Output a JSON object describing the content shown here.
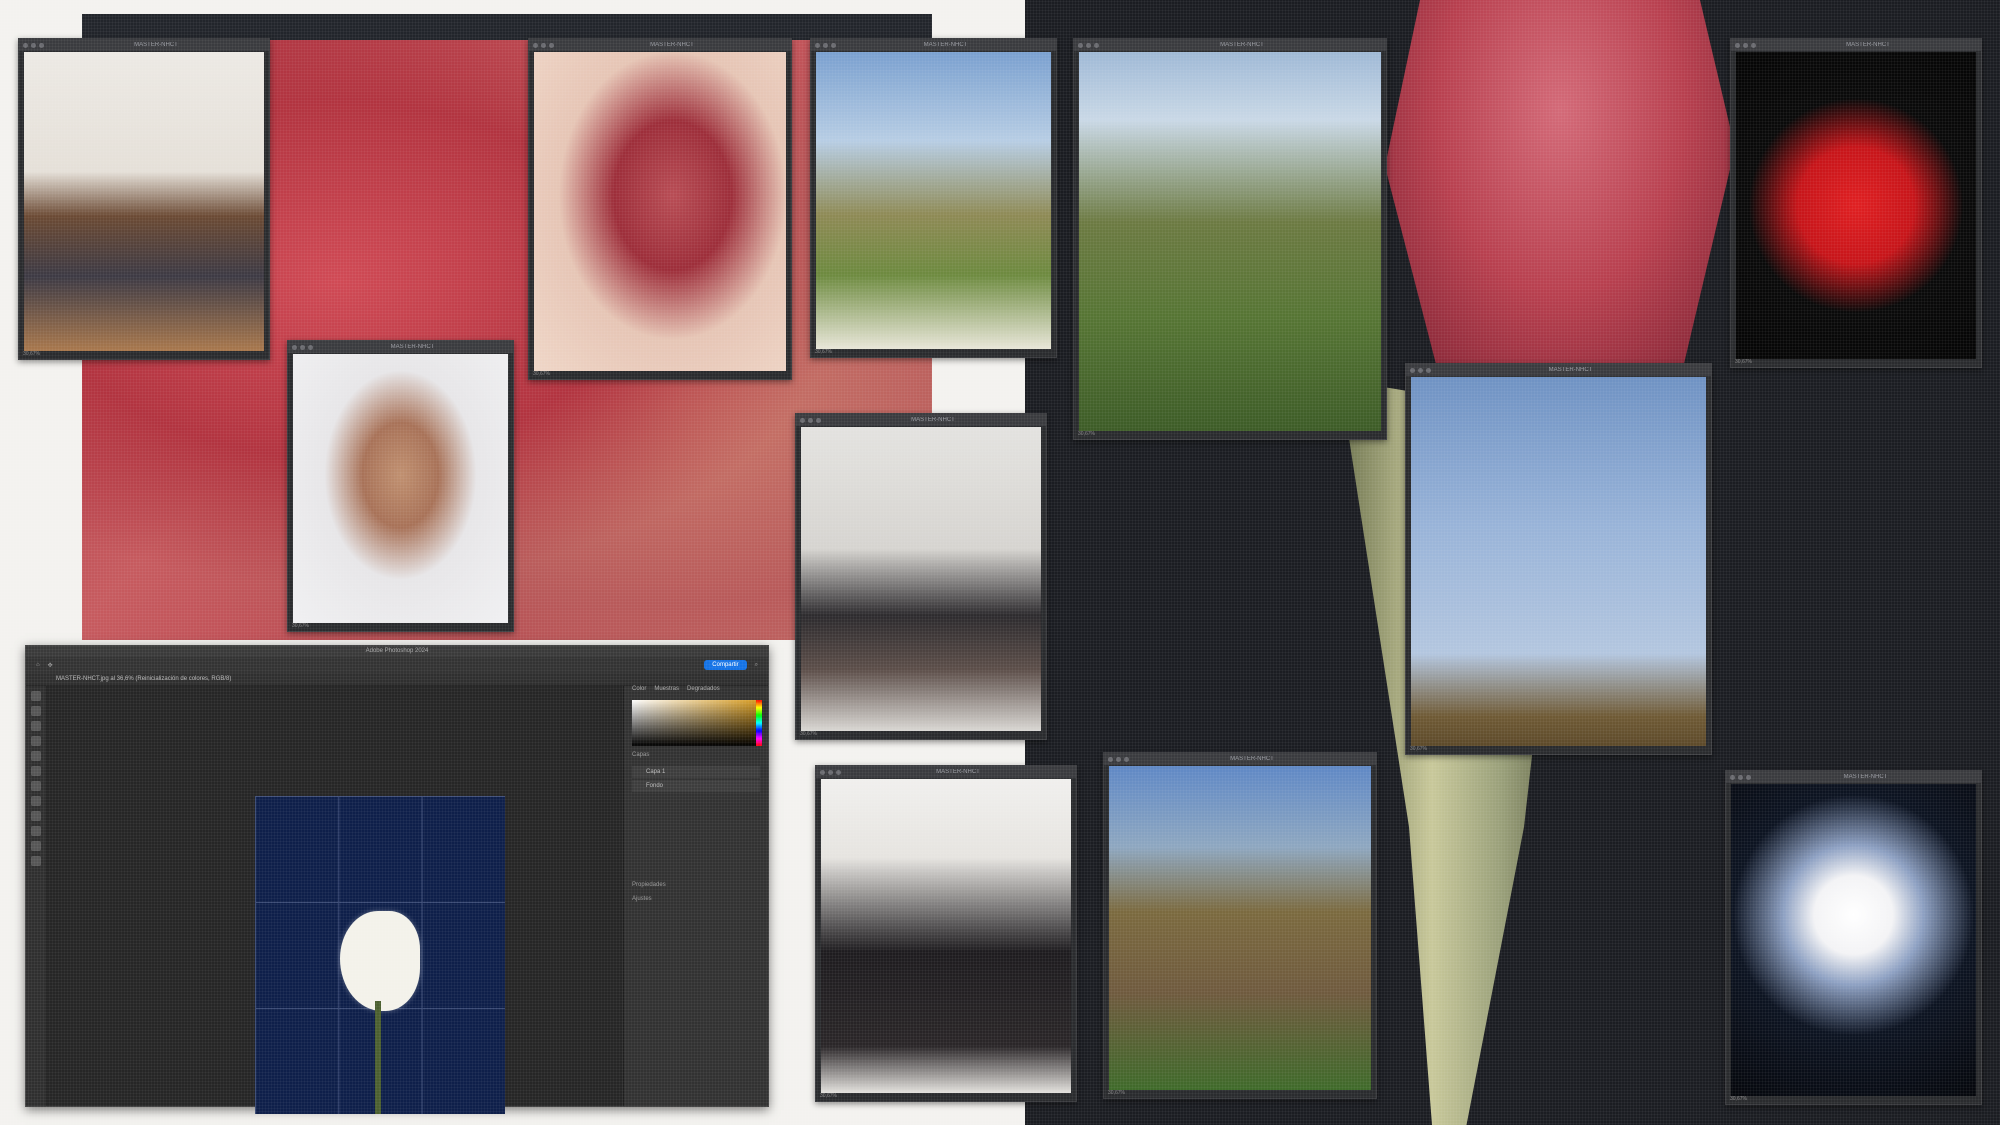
{
  "windows": [
    {
      "id": "w1",
      "title": "MASTER-NHCT",
      "footer": "30,67%"
    },
    {
      "id": "w2",
      "title": "MASTER-NHCT",
      "footer": "30,67%"
    },
    {
      "id": "w3",
      "title": "MASTER-NHCT",
      "footer": "30,67%"
    },
    {
      "id": "w4",
      "title": "MASTER-NHCT",
      "footer": "30,67%"
    },
    {
      "id": "w5",
      "title": "MASTER-NHCT",
      "footer": "30,67%"
    },
    {
      "id": "w6",
      "title": "MASTER-NHCT",
      "footer": "30,67%"
    },
    {
      "id": "w7",
      "title": "MASTER-NHCT",
      "footer": "30,67%"
    },
    {
      "id": "w8",
      "title": "MASTER-NHCT",
      "footer": "30,67%"
    },
    {
      "id": "w9",
      "title": "MASTER-NHCT",
      "footer": "30,67%"
    },
    {
      "id": "w10",
      "title": "MASTER-NHCT",
      "footer": "30,67%"
    },
    {
      "id": "w11",
      "title": "MASTER-NHCT",
      "footer": "30,67%"
    }
  ],
  "photoshop": {
    "app_title": "Adobe Photoshop 2024",
    "share_label": "Compartir",
    "document_tab": "MASTER-NHCT.jpg al 36,6% (Reinicialización de colores, RGB/8)",
    "panel_tabs": [
      "Color",
      "Muestras",
      "Degradados"
    ],
    "section_layers": "Capas",
    "layers": [
      "Capa 1",
      "Fondo"
    ],
    "section_properties": "Propiedades",
    "section_adjust": "Ajustes",
    "colors": {
      "accent": "#1473e6"
    }
  }
}
